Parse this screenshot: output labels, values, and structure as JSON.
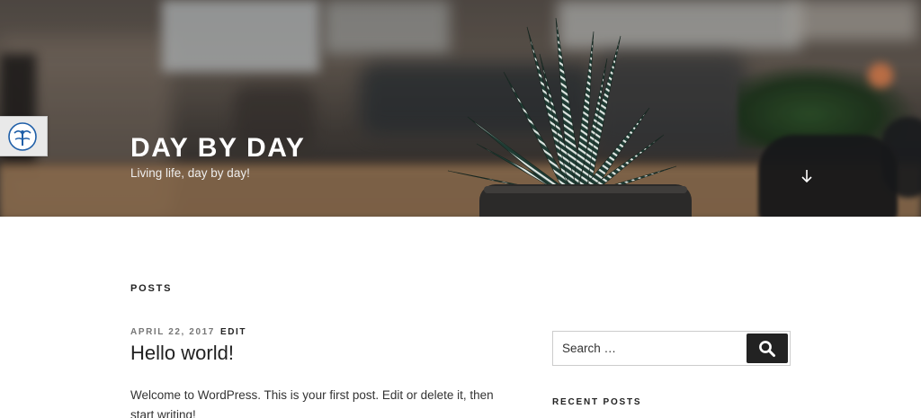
{
  "header": {
    "site_title": "DAY BY DAY",
    "site_description": "Living life, day by day!",
    "scroll_down_icon": "arrow-down-icon"
  },
  "side_widget": {
    "icon": "dragonfly-logo-icon"
  },
  "main": {
    "page_title": "POSTS",
    "posts": [
      {
        "date": "APRIL 22, 2017",
        "edit_label": "EDIT",
        "title": "Hello world!",
        "excerpt": "Welcome to WordPress. This is your first post. Edit or delete it, then start writing!"
      }
    ]
  },
  "sidebar": {
    "search": {
      "placeholder": "Search …",
      "submit_icon": "search-icon"
    },
    "recent_posts_title": "RECENT POSTS"
  },
  "colors": {
    "text_dark": "#222222",
    "text_meta": "#767676",
    "search_button": "#222222",
    "header_title": "#ffffff"
  }
}
